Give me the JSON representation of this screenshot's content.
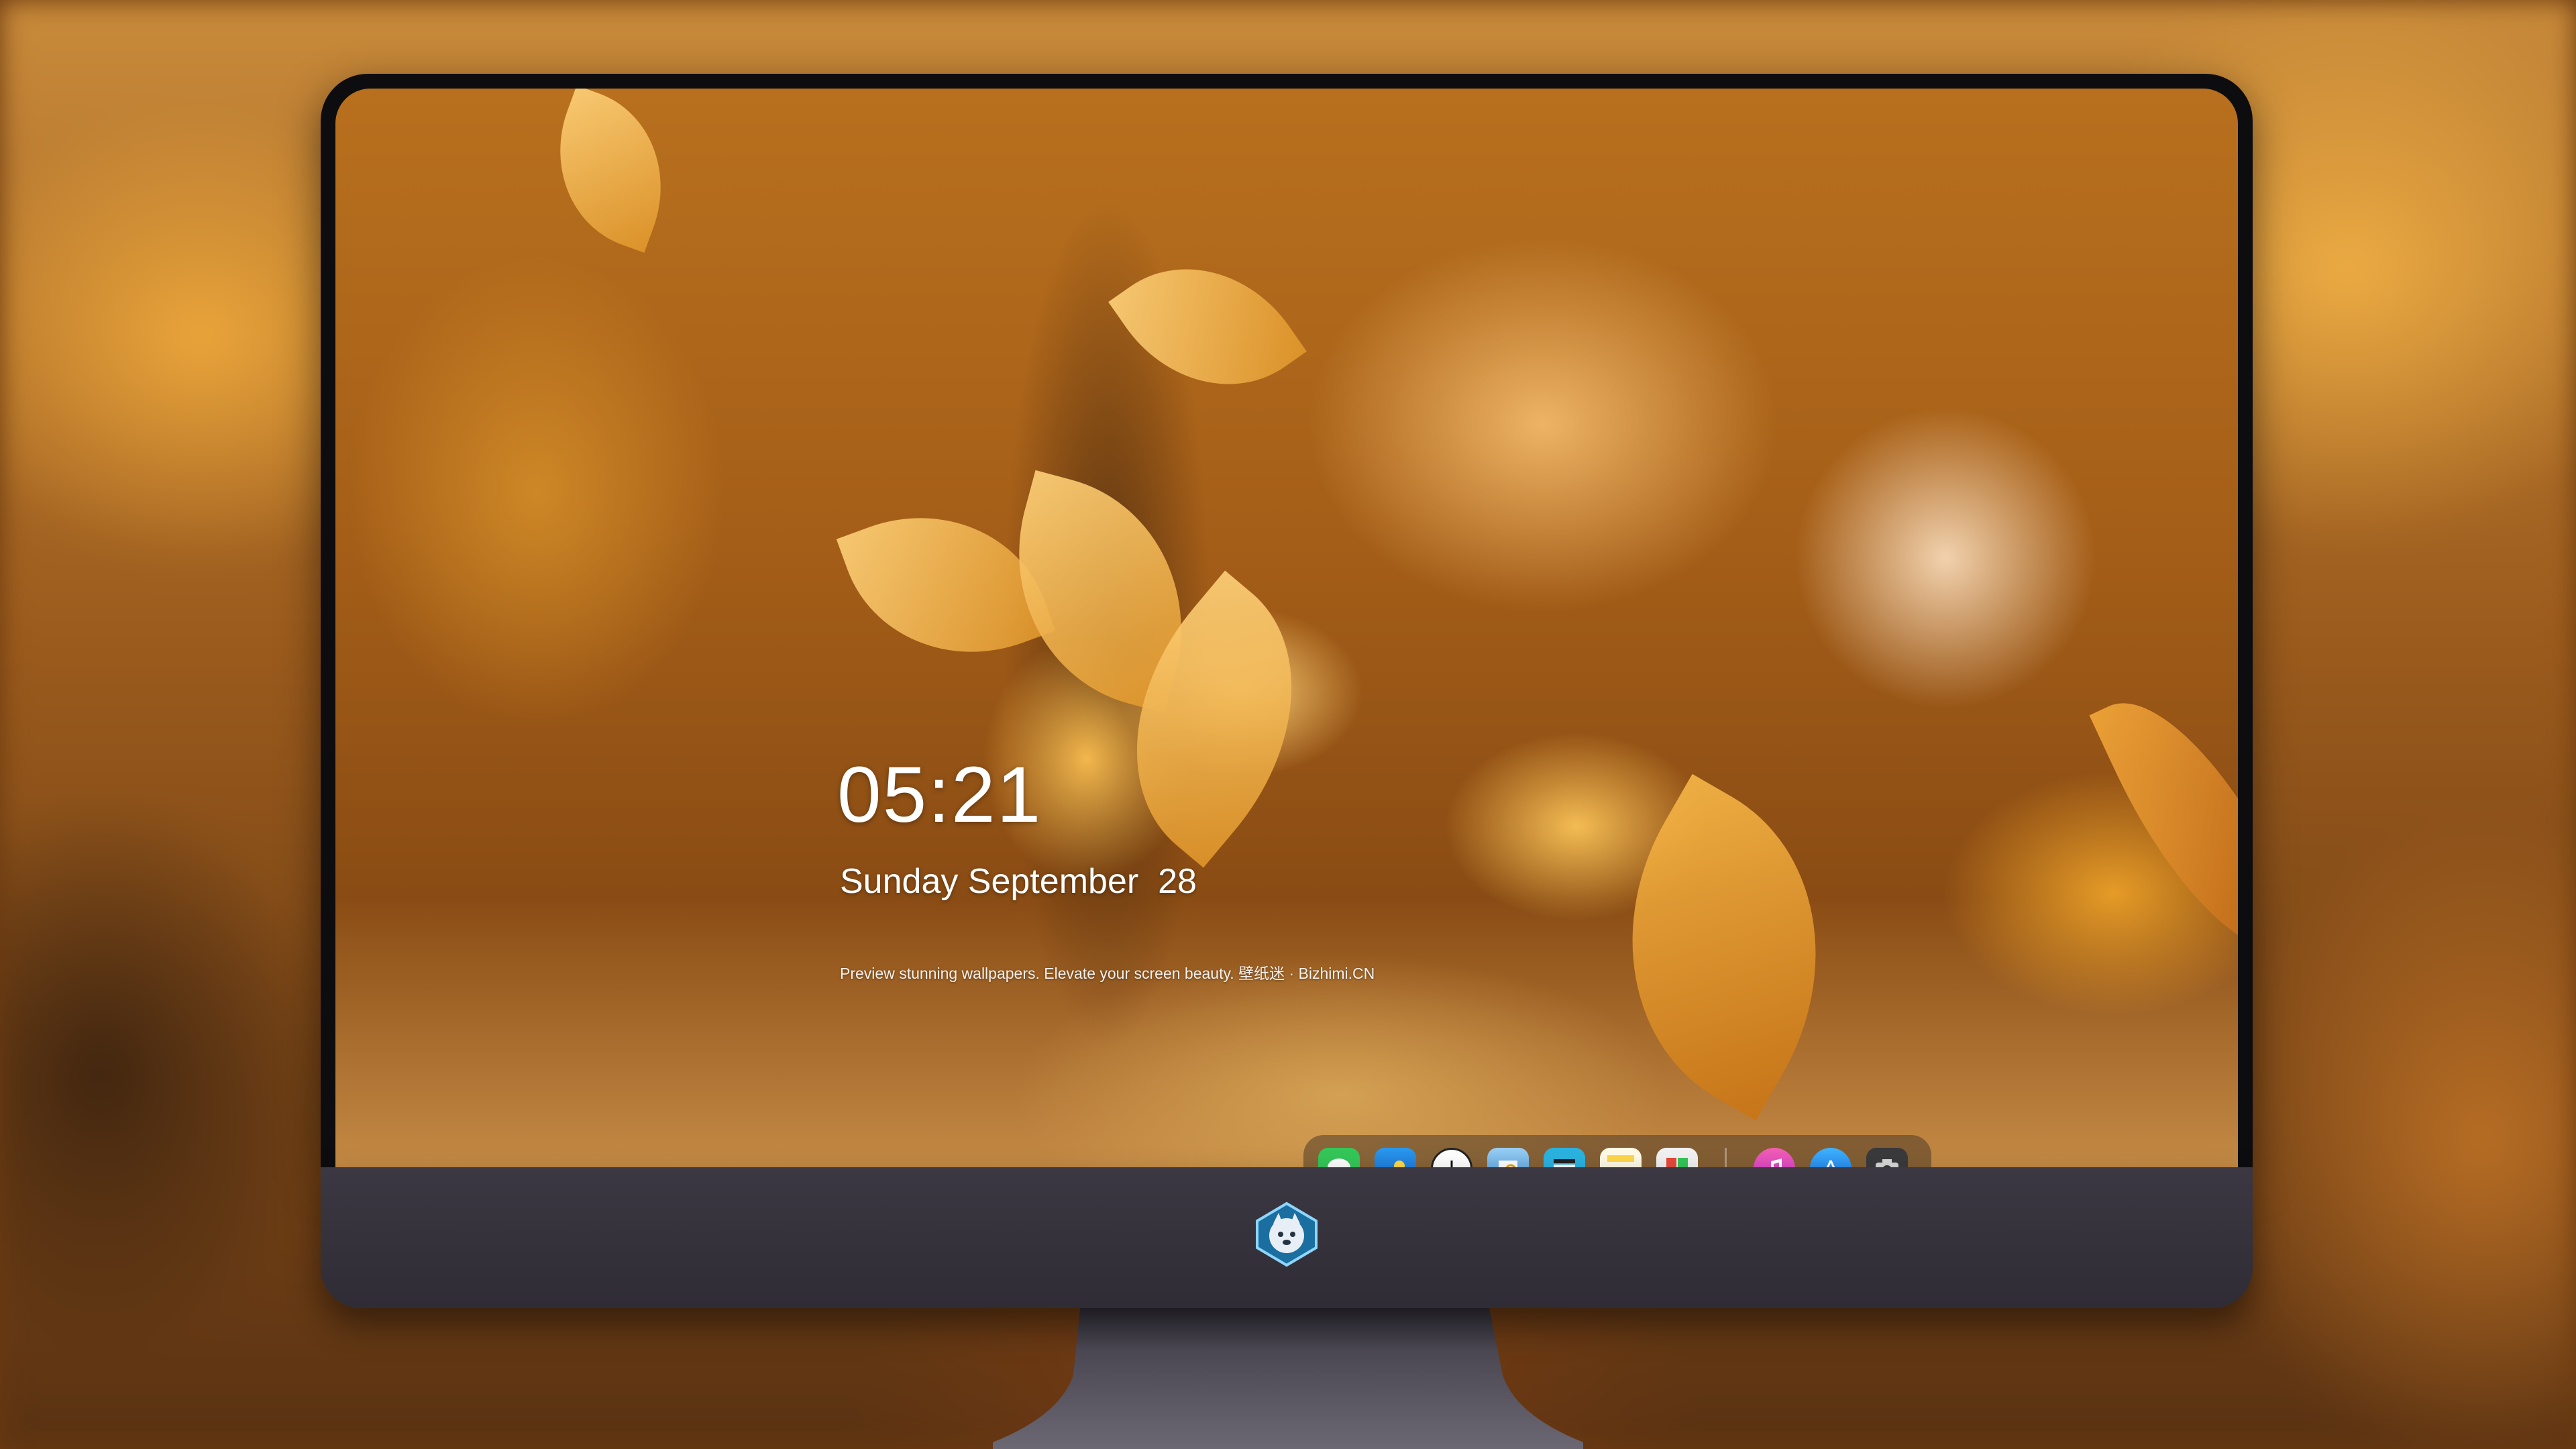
{
  "lockscreen": {
    "time": "05:21",
    "date": "Sunday September  28",
    "tagline": "Preview stunning wallpapers. Elevate your screen beauty. 壁纸迷 · Bizhimi.CN"
  },
  "dock": {
    "apps": [
      {
        "name": "Messages",
        "icon": "messages-icon",
        "color": "#34c759"
      },
      {
        "name": "Weather",
        "icon": "weather-icon",
        "color": "#1e88e5"
      },
      {
        "name": "Clock",
        "icon": "clock-icon",
        "color": "#ffffff"
      },
      {
        "name": "Preview",
        "icon": "preview-icon",
        "color": "#4aa3df"
      },
      {
        "name": "Clips",
        "icon": "clips-icon",
        "color": "#2bb3e0"
      },
      {
        "name": "Notes",
        "icon": "notes-icon",
        "color": "#ffd84a"
      },
      {
        "name": "Photo Booth",
        "icon": "photo-booth-icon",
        "color": "#e64a3b"
      },
      {
        "name": "iTunes",
        "icon": "music-icon",
        "color": "#e84ba8"
      },
      {
        "name": "App Store",
        "icon": "app-store-icon",
        "color": "#1f8ef1"
      },
      {
        "name": "Camera",
        "icon": "camera-icon",
        "color": "#3a3a3c"
      }
    ]
  },
  "brand": {
    "logo": "wolf-mascot-logo"
  }
}
